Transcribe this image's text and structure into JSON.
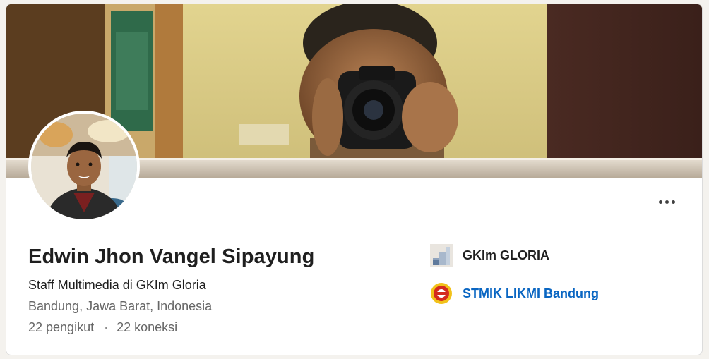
{
  "profile": {
    "name": "Edwin Jhon Vangel Sipayung",
    "headline": "Staff Multimedia di GKIm Gloria",
    "location": "Bandung, Jawa Barat, Indonesia",
    "followers": "22 pengikut",
    "separator": "·",
    "connections": "22 koneksi"
  },
  "orgs": [
    {
      "name": "GKIm GLORIA",
      "icon": "company-logo-placeholder-icon"
    },
    {
      "name": "STMIK LIKMI Bandung",
      "icon": "school-logo-icon"
    }
  ],
  "colors": {
    "link": "#0a66c2",
    "text_primary": "#1f1f1f",
    "text_secondary": "#666666"
  }
}
